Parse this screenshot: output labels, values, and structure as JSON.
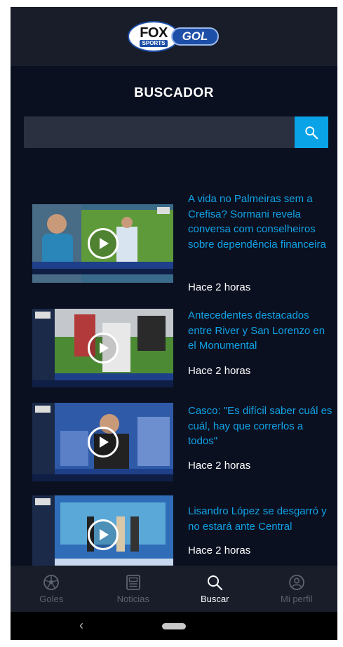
{
  "header": {
    "logo_fox": "FOX",
    "logo_sports": "SPORTS",
    "logo_gol": "GOL"
  },
  "page": {
    "title": "BUSCADOR"
  },
  "search": {
    "value": "",
    "placeholder": "",
    "icon": "search-icon"
  },
  "results": [
    {
      "headline": "A vida no Palmeiras sem a Crefisa? Sormani revela conversa com conselheiros sobre dependência financeira",
      "time": "Hace 2 horas",
      "icon": "play-icon"
    },
    {
      "headline": "Antecedentes destacados entre River y San Lorenzo en el Monumental",
      "time": "Hace 2 horas",
      "icon": "play-icon"
    },
    {
      "headline": "Casco: \"Es difícil saber cuál es cuál, hay que correrlos a todos\"",
      "time": "Hace 2 horas",
      "icon": "play-icon"
    },
    {
      "headline": "Lisandro López se desgarró y no estará ante Central",
      "time": "Hace 2 horas",
      "icon": "play-icon"
    }
  ],
  "bottom_nav": [
    {
      "label": "Goles",
      "icon": "soccer-ball-icon",
      "active": false
    },
    {
      "label": "Noticias",
      "icon": "news-icon",
      "active": false
    },
    {
      "label": "Buscar",
      "icon": "search-icon",
      "active": true
    },
    {
      "label": "Mi perfil",
      "icon": "profile-icon",
      "active": false
    }
  ],
  "system_nav": {
    "back_icon": "back-chevron-icon",
    "home_icon": "home-pill-icon"
  },
  "colors": {
    "accent": "#0aa3e8",
    "headline": "#10a3e6",
    "background": "#0b1020",
    "bar": "#181d29"
  }
}
